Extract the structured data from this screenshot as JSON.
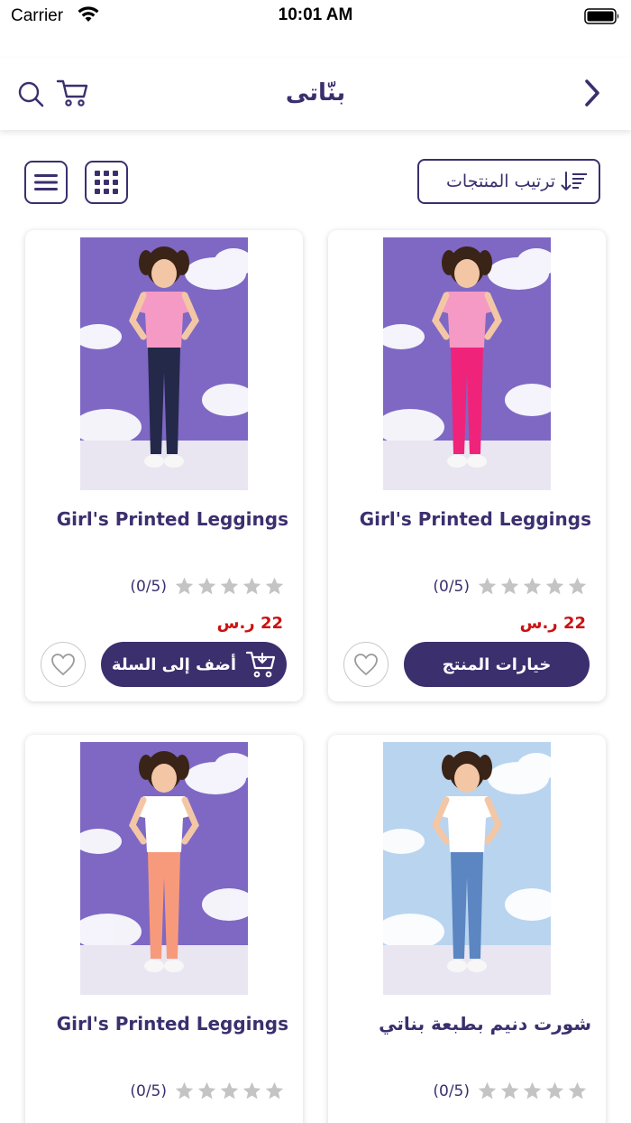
{
  "status_bar": {
    "carrier": "Carrier",
    "time": "10:01 AM"
  },
  "header": {
    "title": "بنّاتى"
  },
  "toolbar": {
    "sort_label": "ترتيب المنتجات"
  },
  "products": [
    {
      "title": "Girl's Printed Leggings",
      "rating_text": "(0/5)",
      "rating_value": 0,
      "price": "22 ر.س",
      "primary_action": "خيارات المنتج",
      "image_colors": {
        "background": "#7e68c4",
        "top": "#f49ac4",
        "bottom": "#f0237a"
      }
    },
    {
      "title": "Girl's Printed Leggings",
      "rating_text": "(0/5)",
      "rating_value": 0,
      "price": "22 ر.س",
      "primary_action": "أضف إلى السلة",
      "image_colors": {
        "background": "#7e68c4",
        "top": "#f49ac4",
        "bottom": "#24294a"
      }
    },
    {
      "title": "شورت دنيم بطبعة بناتي",
      "rating_text": "(0/5)",
      "rating_value": 0,
      "price": "",
      "primary_action": "",
      "image_colors": {
        "background": "#b9d4ee",
        "top": "#ffffff",
        "bottom": "#5b86c2"
      }
    },
    {
      "title": "Girl's Printed Leggings",
      "rating_text": "(0/5)",
      "rating_value": 0,
      "price": "",
      "primary_action": "",
      "image_colors": {
        "background": "#7e68c4",
        "top": "#ffffff",
        "bottom": "#f79a7c"
      }
    }
  ],
  "colors": {
    "brand": "#3b2f6e",
    "price": "#cc1111",
    "star_empty": "#c4c4c4"
  }
}
